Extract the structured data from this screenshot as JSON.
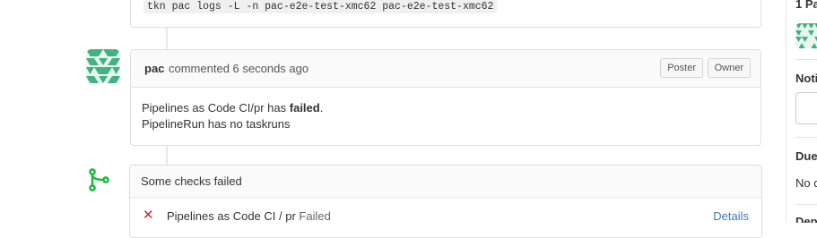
{
  "top_box": {
    "command": "tkn pac logs -L -n pac-e2e-test-xmc62 pac-e2e-test-xmc62"
  },
  "comment": {
    "author": "pac",
    "action": "commented 6 seconds ago",
    "badges": [
      "Poster",
      "Owner"
    ],
    "body_line1_prefix": "Pipelines as Code CI/pr has ",
    "body_line1_bold": "failed",
    "body_line1_suffix": ".",
    "body_line2": "PipelineRun has no taskruns"
  },
  "checks": {
    "title": "Some checks failed",
    "rows": [
      {
        "name": "Pipelines as Code CI / pr",
        "status": "Failed",
        "link": "Details"
      }
    ]
  },
  "sidebar": {
    "participants_label": "1 Pa",
    "notifications_label": "Noti",
    "due_label": "Due",
    "due_value": "No d",
    "dependencies_label": "Dep"
  },
  "colors": {
    "avatar": "#3fb27f",
    "merge_icon": "#21ba45",
    "fail": "#cb2431",
    "link": "#4078c0"
  }
}
